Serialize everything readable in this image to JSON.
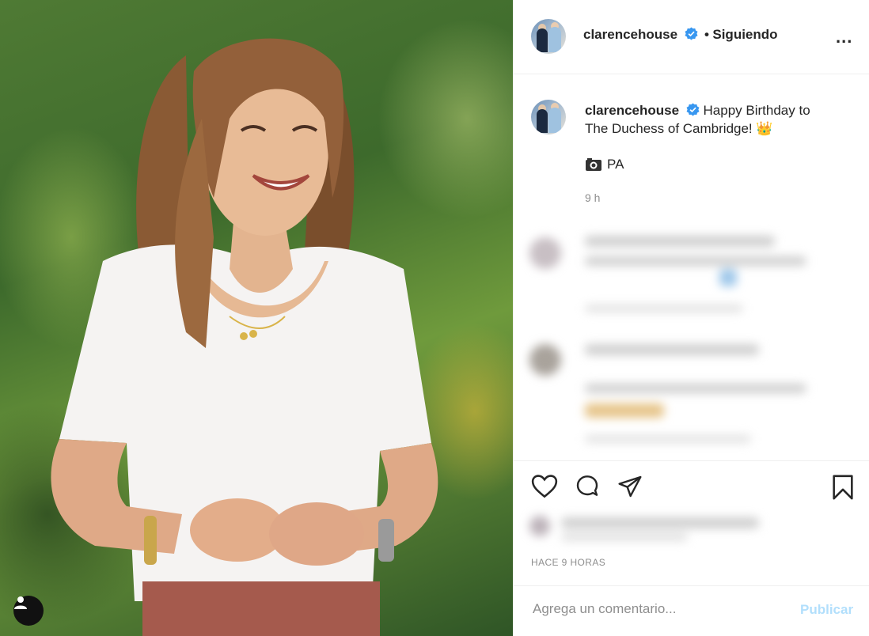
{
  "post": {
    "username": "clarencehouse",
    "follow_separator": "•",
    "follow_status": "Siguiendo",
    "more_label": "...",
    "caption_line1": "Happy Birthday to",
    "caption_line2": "The Duchess of Cambridge!",
    "caption_emoji": "👑",
    "photo_credit_icon": "camera-icon",
    "photo_credit": "PA",
    "relative_time": "9 h",
    "date_label": "HACE 9 HORAS"
  },
  "actions": {
    "like_icon": "heart-icon",
    "comment_icon": "comment-icon",
    "share_icon": "send-icon",
    "save_icon": "bookmark-icon"
  },
  "comment_box": {
    "placeholder": "Agrega un comentario...",
    "publish_label": "Publicar"
  },
  "colors": {
    "text": "#262626",
    "muted": "#8e8e8e",
    "verified_blue": "#3897f0",
    "publish_disabled": "#b2dffc",
    "border": "#efefef"
  }
}
